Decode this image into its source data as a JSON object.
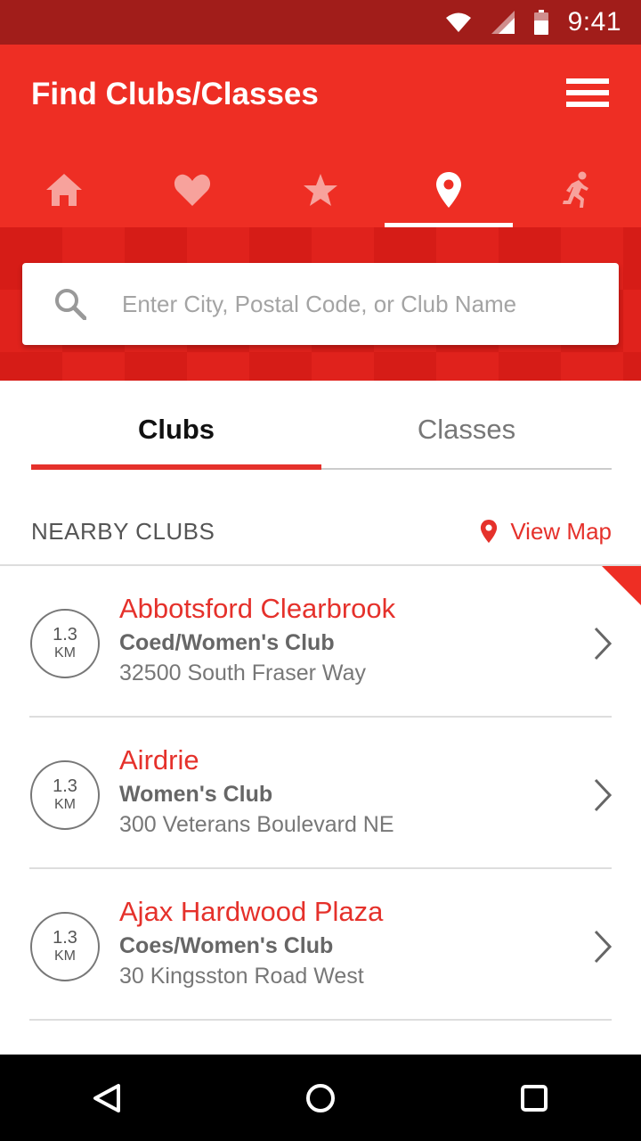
{
  "status_bar": {
    "time": "9:41"
  },
  "header": {
    "title": "Find Clubs/Classes"
  },
  "nav_tabs": [
    {
      "icon": "home-icon",
      "active": false
    },
    {
      "icon": "heart-icon",
      "active": false
    },
    {
      "icon": "star-icon",
      "active": false
    },
    {
      "icon": "location-pin-icon",
      "active": true
    },
    {
      "icon": "runner-icon",
      "active": false
    }
  ],
  "search": {
    "placeholder": "Enter City, Postal Code, or Club Name",
    "value": ""
  },
  "segment_tabs": [
    {
      "label": "Clubs",
      "active": true
    },
    {
      "label": "Classes",
      "active": false
    }
  ],
  "section": {
    "title": "NEARBY CLUBS",
    "view_map_label": "View Map"
  },
  "clubs": [
    {
      "distance": "1.3",
      "unit": "KM",
      "name": "Abbotsford Clearbrook",
      "type": "Coed/Women's Club",
      "address": "32500 South Fraser Way"
    },
    {
      "distance": "1.3",
      "unit": "KM",
      "name": "Airdrie",
      "type": "Women's Club",
      "address": "300 Veterans Boulevard NE"
    },
    {
      "distance": "1.3",
      "unit": "KM",
      "name": "Ajax Hardwood Plaza",
      "type": "Coes/Women's Club",
      "address": "30 Kingsston Road West"
    }
  ],
  "colors": {
    "brand_red": "#ee2e24",
    "status_bar": "#a11d1a",
    "accent_text": "#e5312b"
  }
}
